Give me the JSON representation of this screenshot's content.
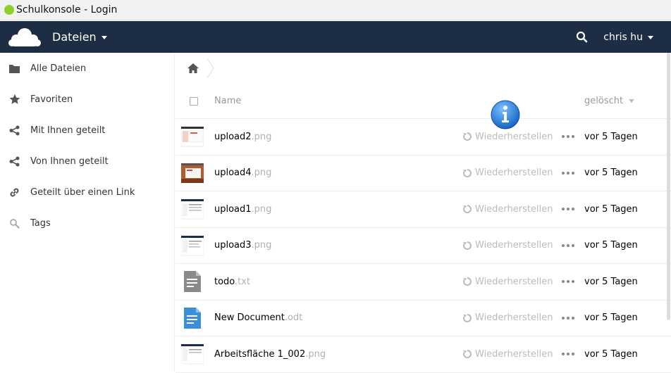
{
  "window": {
    "title": "Schulkonsole - Login"
  },
  "header": {
    "app_menu_label": "Dateien",
    "user_label": "chris hu"
  },
  "sidebar": {
    "items": [
      {
        "label": "Alle Dateien",
        "icon": "folder-icon"
      },
      {
        "label": "Favoriten",
        "icon": "star-icon"
      },
      {
        "label": "Mit Ihnen geteilt",
        "icon": "share-icon"
      },
      {
        "label": "Von Ihnen geteilt",
        "icon": "share-icon"
      },
      {
        "label": "Geteilt über einen Link",
        "icon": "link-icon"
      },
      {
        "label": "Tags",
        "icon": "tag-search-icon"
      }
    ]
  },
  "list": {
    "col_name": "Name",
    "col_deleted": "gelöscht",
    "restore_label": "Wiederherstellen",
    "rows": [
      {
        "name": "upload2",
        "ext": ".png",
        "date": "vor 5 Tagen",
        "thumb": "screenshot"
      },
      {
        "name": "upload4",
        "ext": ".png",
        "date": "vor 5 Tagen",
        "thumb": "photo"
      },
      {
        "name": "upload1",
        "ext": ".png",
        "date": "vor 5 Tagen",
        "thumb": "screenshot"
      },
      {
        "name": "upload3",
        "ext": ".png",
        "date": "vor 5 Tagen",
        "thumb": "screenshot"
      },
      {
        "name": "todo",
        "ext": ".txt",
        "date": "vor 5 Tagen",
        "thumb": "text-file"
      },
      {
        "name": "New Document",
        "ext": ".odt",
        "date": "vor 5 Tagen",
        "thumb": "document-file"
      },
      {
        "name": "Arbeitsfläche 1_002",
        "ext": ".png",
        "date": "vor 5 Tagen",
        "thumb": "screenshot"
      }
    ]
  },
  "colors": {
    "header_bg": "#1d2d44",
    "accent_green": "#8fd12a",
    "info_blue": "#2a7fd4"
  }
}
